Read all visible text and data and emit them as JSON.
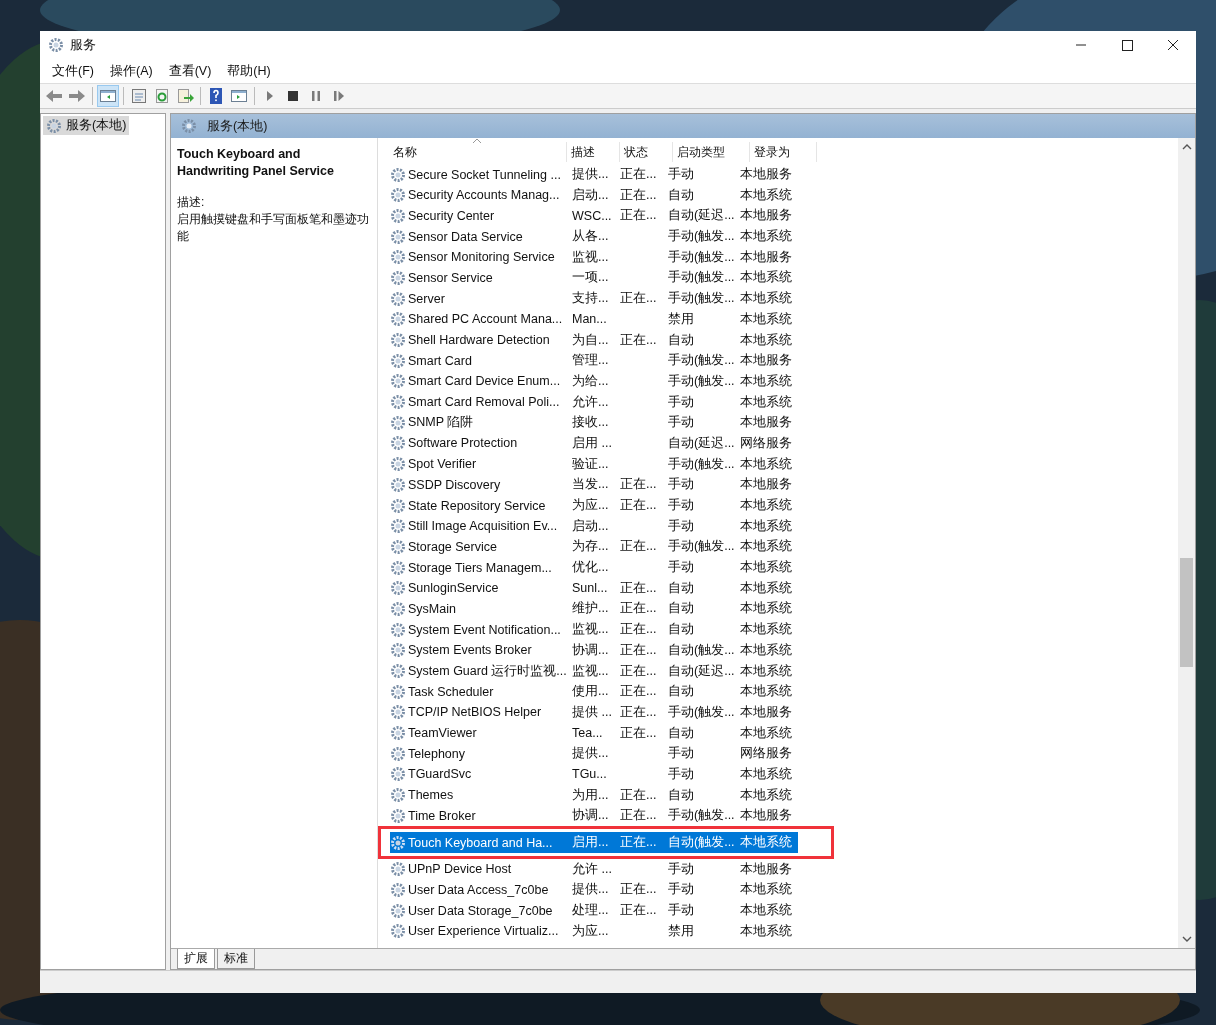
{
  "window": {
    "title": "服务"
  },
  "menu": [
    "文件(F)",
    "操作(A)",
    "查看(V)",
    "帮助(H)"
  ],
  "tree": {
    "items": [
      {
        "label": "服务(本地)",
        "selected": true
      }
    ]
  },
  "pane_title": "服务(本地)",
  "details": {
    "service_name": "Touch Keyboard and Handwriting Panel Service",
    "description_label": "描述:",
    "description": "启用触摸键盘和手写面板笔和墨迹功能"
  },
  "table": {
    "columns": [
      "名称",
      "描述",
      "状态",
      "启动类型",
      "登录为"
    ],
    "rows": [
      {
        "name": "Secure Socket Tunneling ...",
        "description": "提供...",
        "status": "正在...",
        "startup_type": "手动",
        "log_on_as": "本地服务",
        "selected": false,
        "circled": false
      },
      {
        "name": "Security Accounts Manag...",
        "description": "启动...",
        "status": "正在...",
        "startup_type": "自动",
        "log_on_as": "本地系统",
        "selected": false,
        "circled": false
      },
      {
        "name": "Security Center",
        "description": "WSC...",
        "status": "正在...",
        "startup_type": "自动(延迟...",
        "log_on_as": "本地服务",
        "selected": false,
        "circled": false
      },
      {
        "name": "Sensor Data Service",
        "description": "从各...",
        "status": "",
        "startup_type": "手动(触发...",
        "log_on_as": "本地系统",
        "selected": false,
        "circled": false
      },
      {
        "name": "Sensor Monitoring Service",
        "description": "监视...",
        "status": "",
        "startup_type": "手动(触发...",
        "log_on_as": "本地服务",
        "selected": false,
        "circled": false
      },
      {
        "name": "Sensor Service",
        "description": "一项...",
        "status": "",
        "startup_type": "手动(触发...",
        "log_on_as": "本地系统",
        "selected": false,
        "circled": false
      },
      {
        "name": "Server",
        "description": "支持...",
        "status": "正在...",
        "startup_type": "手动(触发...",
        "log_on_as": "本地系统",
        "selected": false,
        "circled": false
      },
      {
        "name": "Shared PC Account Mana...",
        "description": "Man...",
        "status": "",
        "startup_type": "禁用",
        "log_on_as": "本地系统",
        "selected": false,
        "circled": false
      },
      {
        "name": "Shell Hardware Detection",
        "description": "为自...",
        "status": "正在...",
        "startup_type": "自动",
        "log_on_as": "本地系统",
        "selected": false,
        "circled": false
      },
      {
        "name": "Smart Card",
        "description": "管理...",
        "status": "",
        "startup_type": "手动(触发...",
        "log_on_as": "本地服务",
        "selected": false,
        "circled": false
      },
      {
        "name": "Smart Card Device Enum...",
        "description": "为给...",
        "status": "",
        "startup_type": "手动(触发...",
        "log_on_as": "本地系统",
        "selected": false,
        "circled": false
      },
      {
        "name": "Smart Card Removal Poli...",
        "description": "允许...",
        "status": "",
        "startup_type": "手动",
        "log_on_as": "本地系统",
        "selected": false,
        "circled": false
      },
      {
        "name": "SNMP 陷阱",
        "description": "接收...",
        "status": "",
        "startup_type": "手动",
        "log_on_as": "本地服务",
        "selected": false,
        "circled": false
      },
      {
        "name": "Software Protection",
        "description": "启用 ...",
        "status": "",
        "startup_type": "自动(延迟...",
        "log_on_as": "网络服务",
        "selected": false,
        "circled": false
      },
      {
        "name": "Spot Verifier",
        "description": "验证...",
        "status": "",
        "startup_type": "手动(触发...",
        "log_on_as": "本地系统",
        "selected": false,
        "circled": false
      },
      {
        "name": "SSDP Discovery",
        "description": "当发...",
        "status": "正在...",
        "startup_type": "手动",
        "log_on_as": "本地服务",
        "selected": false,
        "circled": false
      },
      {
        "name": "State Repository Service",
        "description": "为应...",
        "status": "正在...",
        "startup_type": "手动",
        "log_on_as": "本地系统",
        "selected": false,
        "circled": false
      },
      {
        "name": "Still Image Acquisition Ev...",
        "description": "启动...",
        "status": "",
        "startup_type": "手动",
        "log_on_as": "本地系统",
        "selected": false,
        "circled": false
      },
      {
        "name": "Storage Service",
        "description": "为存...",
        "status": "正在...",
        "startup_type": "手动(触发...",
        "log_on_as": "本地系统",
        "selected": false,
        "circled": false
      },
      {
        "name": "Storage Tiers Managem...",
        "description": "优化...",
        "status": "",
        "startup_type": "手动",
        "log_on_as": "本地系统",
        "selected": false,
        "circled": false
      },
      {
        "name": "SunloginService",
        "description": "Sunl...",
        "status": "正在...",
        "startup_type": "自动",
        "log_on_as": "本地系统",
        "selected": false,
        "circled": false
      },
      {
        "name": "SysMain",
        "description": "维护...",
        "status": "正在...",
        "startup_type": "自动",
        "log_on_as": "本地系统",
        "selected": false,
        "circled": false
      },
      {
        "name": "System Event Notification...",
        "description": "监视...",
        "status": "正在...",
        "startup_type": "自动",
        "log_on_as": "本地系统",
        "selected": false,
        "circled": false
      },
      {
        "name": "System Events Broker",
        "description": "协调...",
        "status": "正在...",
        "startup_type": "自动(触发...",
        "log_on_as": "本地系统",
        "selected": false,
        "circled": false
      },
      {
        "name": "System Guard 运行时监视...",
        "description": "监视...",
        "status": "正在...",
        "startup_type": "自动(延迟...",
        "log_on_as": "本地系统",
        "selected": false,
        "circled": false
      },
      {
        "name": "Task Scheduler",
        "description": "使用...",
        "status": "正在...",
        "startup_type": "自动",
        "log_on_as": "本地系统",
        "selected": false,
        "circled": false
      },
      {
        "name": "TCP/IP NetBIOS Helper",
        "description": "提供 ...",
        "status": "正在...",
        "startup_type": "手动(触发...",
        "log_on_as": "本地服务",
        "selected": false,
        "circled": false
      },
      {
        "name": "TeamViewer",
        "description": "Tea...",
        "status": "正在...",
        "startup_type": "自动",
        "log_on_as": "本地系统",
        "selected": false,
        "circled": false
      },
      {
        "name": "Telephony",
        "description": "提供...",
        "status": "",
        "startup_type": "手动",
        "log_on_as": "网络服务",
        "selected": false,
        "circled": false
      },
      {
        "name": "TGuardSvc",
        "description": "TGu...",
        "status": "",
        "startup_type": "手动",
        "log_on_as": "本地系统",
        "selected": false,
        "circled": false
      },
      {
        "name": "Themes",
        "description": "为用...",
        "status": "正在...",
        "startup_type": "自动",
        "log_on_as": "本地系统",
        "selected": false,
        "circled": false
      },
      {
        "name": "Time Broker",
        "description": "协调...",
        "status": "正在...",
        "startup_type": "手动(触发...",
        "log_on_as": "本地服务",
        "selected": false,
        "circled": false
      },
      {
        "name": "Touch Keyboard and Ha...",
        "description": "启用...",
        "status": "正在...",
        "startup_type": "自动(触发...",
        "log_on_as": "本地系统",
        "selected": true,
        "circled": true
      },
      {
        "name": "UPnP Device Host",
        "description": "允许 ...",
        "status": "",
        "startup_type": "手动",
        "log_on_as": "本地服务",
        "selected": false,
        "circled": false
      },
      {
        "name": "User Data Access_7c0be",
        "description": "提供...",
        "status": "正在...",
        "startup_type": "手动",
        "log_on_as": "本地系统",
        "selected": false,
        "circled": false
      },
      {
        "name": "User Data Storage_7c0be",
        "description": "处理...",
        "status": "正在...",
        "startup_type": "手动",
        "log_on_as": "本地系统",
        "selected": false,
        "circled": false
      },
      {
        "name": "User Experience Virtualiz...",
        "description": "为应...",
        "status": "",
        "startup_type": "禁用",
        "log_on_as": "本地系统",
        "selected": false,
        "circled": false
      }
    ]
  },
  "view_tabs": [
    {
      "label": "扩展",
      "selected": true
    },
    {
      "label": "标准",
      "selected": false
    }
  ]
}
